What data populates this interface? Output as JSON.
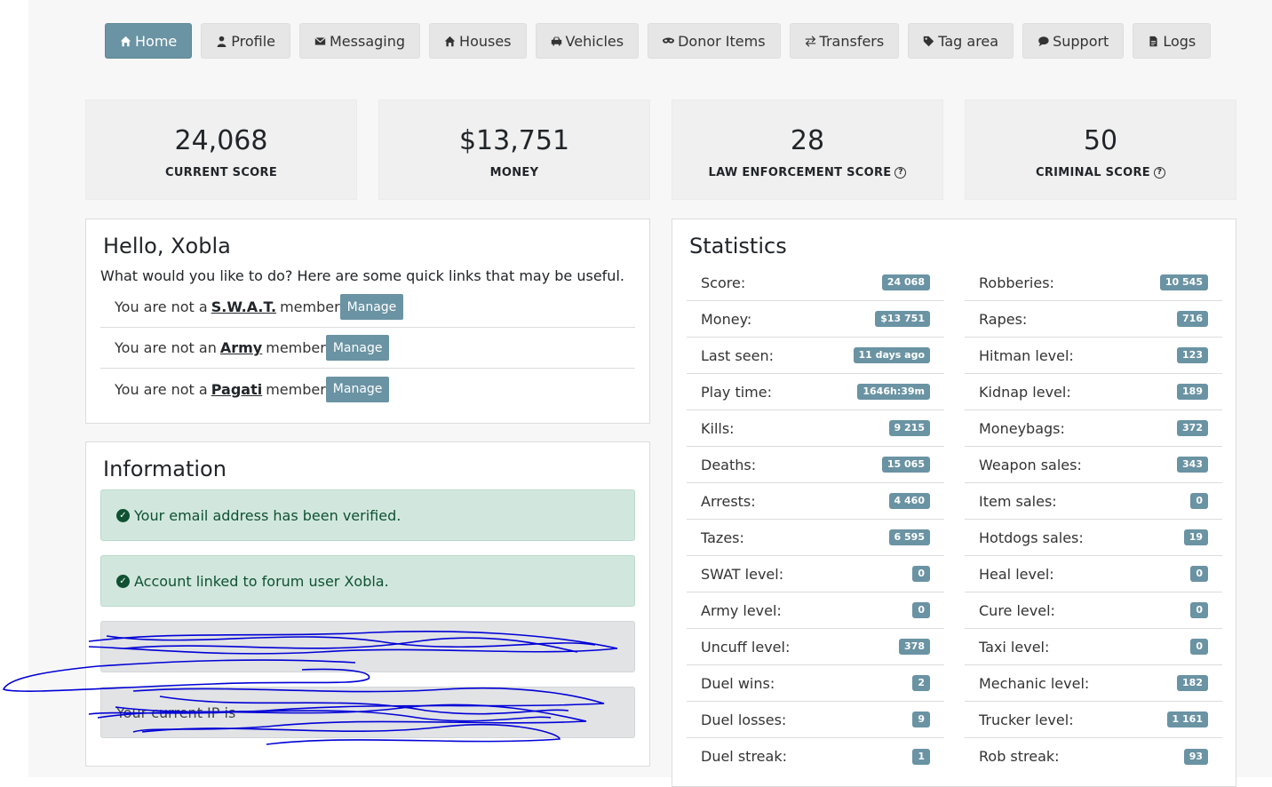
{
  "nav": [
    {
      "label": "Home",
      "icon": "home-icon",
      "active": true
    },
    {
      "label": "Profile",
      "icon": "user-icon"
    },
    {
      "label": "Messaging",
      "icon": "envelope-icon"
    },
    {
      "label": "Houses",
      "icon": "home-icon"
    },
    {
      "label": "Vehicles",
      "icon": "car-icon"
    },
    {
      "label": "Donor Items",
      "icon": "mask-icon"
    },
    {
      "label": "Transfers",
      "icon": "transfer-arrows-icon"
    },
    {
      "label": "Tag area",
      "icon": "tag-icon"
    },
    {
      "label": "Support",
      "icon": "chat-bubble-icon"
    },
    {
      "label": "Logs",
      "icon": "file-icon"
    }
  ],
  "scores": [
    {
      "value": "24,068",
      "label": "CURRENT SCORE"
    },
    {
      "value": "$13,751",
      "label": "MONEY"
    },
    {
      "value": "28",
      "label": "LAW ENFORCEMENT SCORE",
      "help_icon": "question-circle-icon"
    },
    {
      "value": "50",
      "label": "CRIMINAL SCORE",
      "help_icon": "question-circle-icon"
    }
  ],
  "hello": {
    "title": "Hello, Xobla",
    "text": "What would you like to do? Here are some quick links that may be useful.",
    "rows": [
      {
        "prefix": "You are not a",
        "org": "S.W.A.T.",
        "suffix": "member",
        "button": "Manage"
      },
      {
        "prefix": "You are not an",
        "org": "Army",
        "suffix": "member",
        "button": "Manage"
      },
      {
        "prefix": "You are not a",
        "org": "Pagati",
        "suffix": "member",
        "button": "Manage"
      }
    ]
  },
  "information": {
    "title": "Information",
    "alerts": [
      "Your email address has been verified.",
      "Account linked to forum user Xobla."
    ],
    "redacted": [
      "",
      "Your current IP is"
    ]
  },
  "statistics": {
    "title": "Statistics",
    "left": [
      {
        "label": "Score:",
        "value": "24 068"
      },
      {
        "label": "Money:",
        "value": "$13 751"
      },
      {
        "label": "Last seen:",
        "value": "11 days ago"
      },
      {
        "label": "Play time:",
        "value": "1646h:39m"
      },
      {
        "label": "Kills:",
        "value": "9 215"
      },
      {
        "label": "Deaths:",
        "value": "15 065"
      },
      {
        "label": "Arrests:",
        "value": "4 460"
      },
      {
        "label": "Tazes:",
        "value": "6 595"
      },
      {
        "label": "SWAT level:",
        "value": "0"
      },
      {
        "label": "Army level:",
        "value": "0"
      },
      {
        "label": "Uncuff level:",
        "value": "378"
      },
      {
        "label": "Duel wins:",
        "value": "2"
      },
      {
        "label": "Duel losses:",
        "value": "9"
      },
      {
        "label": "Duel streak:",
        "value": "1"
      }
    ],
    "right": [
      {
        "label": "Robberies:",
        "value": "10 545"
      },
      {
        "label": "Rapes:",
        "value": "716"
      },
      {
        "label": "Hitman level:",
        "value": "123"
      },
      {
        "label": "Kidnap level:",
        "value": "189"
      },
      {
        "label": "Moneybags:",
        "value": "372"
      },
      {
        "label": "Weapon sales:",
        "value": "343"
      },
      {
        "label": "Item sales:",
        "value": "0"
      },
      {
        "label": "Hotdogs sales:",
        "value": "19"
      },
      {
        "label": "Heal level:",
        "value": "0"
      },
      {
        "label": "Cure level:",
        "value": "0"
      },
      {
        "label": "Taxi level:",
        "value": "0"
      },
      {
        "label": "Mechanic level:",
        "value": "182"
      },
      {
        "label": "Trucker level:",
        "value": "1 161"
      },
      {
        "label": "Rob streak:",
        "value": "93"
      }
    ]
  },
  "colors": {
    "accent": "#6a93a3",
    "success_bg": "#d1e7dd",
    "secondary_bg": "#e2e3e5",
    "scribble": "#0000d6"
  }
}
